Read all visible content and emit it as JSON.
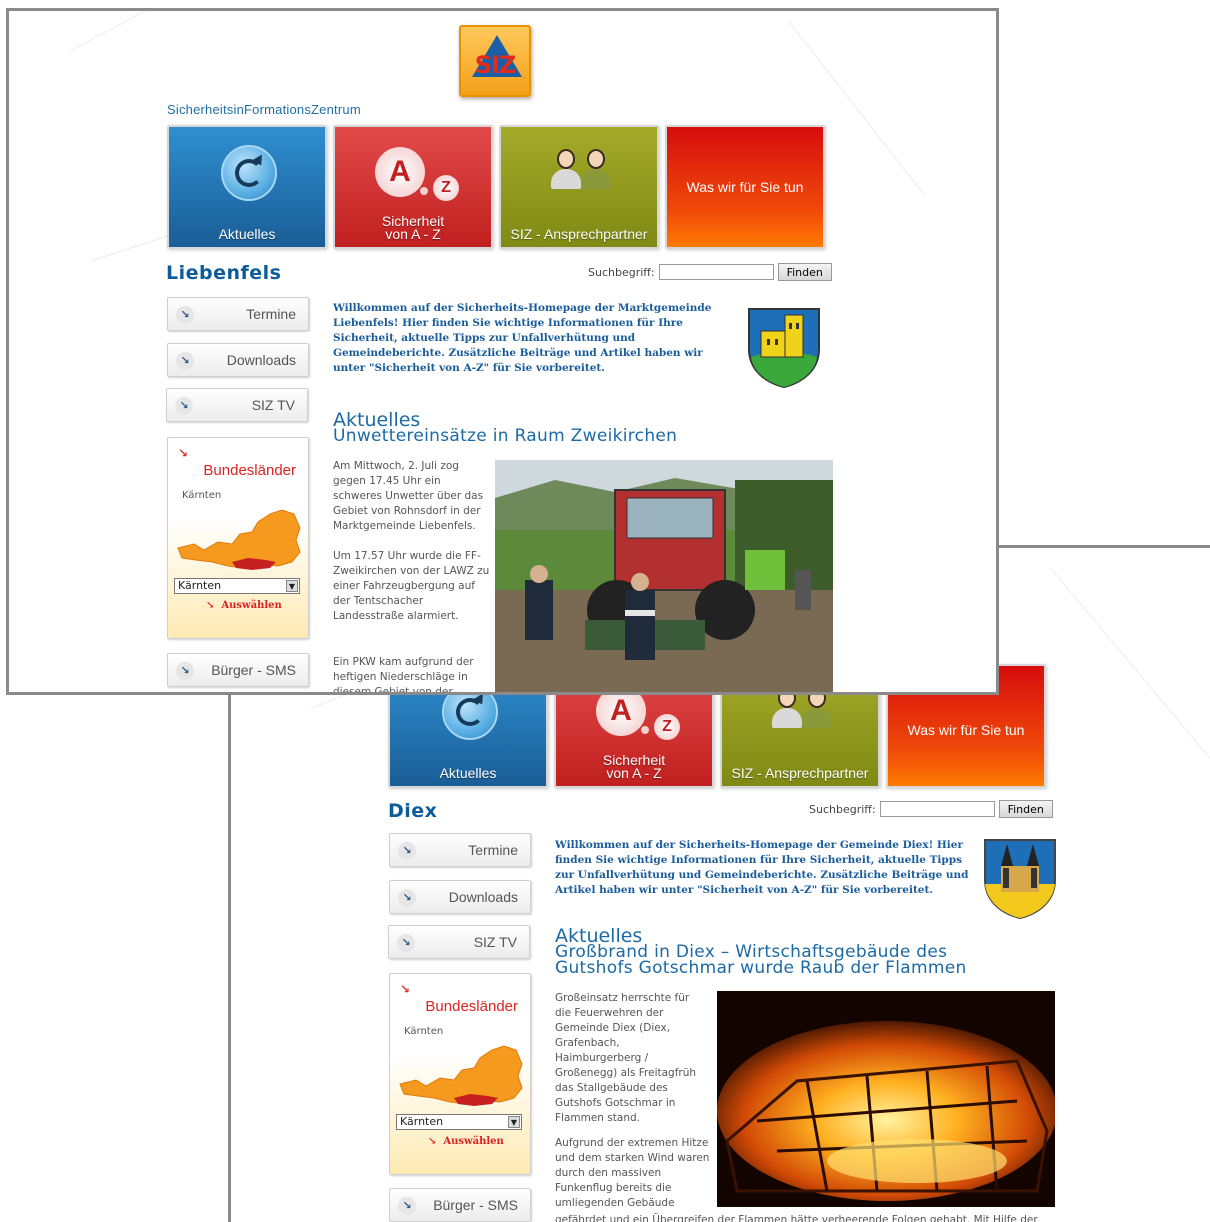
{
  "brand": {
    "logo_text": "SIZ",
    "tagline": "SicherheitsinFormationsZentrum",
    "colors": {
      "blue_tile": "#1a5d96",
      "red_tile": "#c0201f",
      "olive_tile": "#7f8a14",
      "fire_tile": "#f04a0a",
      "link_blue": "#1a5c9a",
      "accent_red": "#d22222"
    }
  },
  "tiles": [
    {
      "label": "Aktuelles",
      "icon": "refresh-icon"
    },
    {
      "label": "Sicherheit von A - Z",
      "line1": "Sicherheit",
      "line2": "von A - Z",
      "icon": "a-to-z-icon",
      "glyph_a": "A",
      "glyph_z": "Z"
    },
    {
      "label": "SIZ - Ansprechpartner",
      "icon": "people-icon"
    },
    {
      "label": "Was wir für Sie tun"
    }
  ],
  "search": {
    "label": "Suchbegriff:",
    "value": "",
    "button": "Finden"
  },
  "nav": {
    "termine": "Termine",
    "downloads": "Downloads",
    "siztv": "SIZ TV",
    "sms": "Bürger - SMS",
    "arrow_glyph": "↘"
  },
  "bundeslaender": {
    "title": "Bundesländer",
    "region": "Kärnten",
    "selected": "Kärnten",
    "action": "Auswählen"
  },
  "pages": [
    {
      "town": "Liebenfels",
      "welcome": "Willkommen auf der Sicherheits-Homepage der Marktgemeinde Liebenfels! Hier finden Sie wichtige Informationen für Ihre Sicherheit, aktuelle Tipps zur Unfallverhütung und Gemeindeberichte. Zusätzliche Beiträge und Artikel haben wir unter \"Sicherheit von A-Z\" für Sie vorbereitet.",
      "section": "Aktuelles",
      "headline": "Unwettereinsätze in Raum Zweikirchen",
      "paragraph1": "Am Mittwoch, 2. Juli zog gegen 17.45 Uhr ein schweres Unwetter über das Gebiet von Rohnsdorf in der Marktgemeinde Liebenfels.",
      "paragraph2": "Um 17.57 Uhr wurde die FF-Zweikirchen von der LAWZ zu einer Fahrzeugbergung auf der Tentschacher Landesstraße alarmiert.",
      "paragraph3": "Ein PKW kam aufgrund der heftigen Niederschläge in diesem Gebiet von der"
    },
    {
      "town": "Diex",
      "welcome": "Willkommen auf der Sicherheits-Homepage der Gemeinde Diex! Hier finden Sie wichtige Informationen für Ihre Sicherheit, aktuelle Tipps zur Unfallverhütung und Gemeindeberichte. Zusätzliche Beiträge und Artikel haben wir unter \"Sicherheit von A-Z\" für Sie vorbereitet.",
      "section": "Aktuelles",
      "headline": "Großbrand in Diex – Wirtschaftsgebäude des Gutshofs Gotschmar wurde Raub der Flammen",
      "paragraph1": "Großeinsatz herrschte für die Feuerwehren der Gemeinde Diex (Diex, Grafenbach, Haimburgerberg / Großenegg) als Freitagfrüh das Stallgebäude des Gutshofs Gotschmar in Flammen stand.",
      "paragraph2": "Aufgrund der extremen Hitze und dem starken Wind waren durch den massiven Funkenflug bereits die umliegenden Gebäude",
      "footline": "gefährdet und ein Übergreifen der Flammen hätte verheerende Folgen gehabt.  Mit Hilfe der"
    }
  ]
}
